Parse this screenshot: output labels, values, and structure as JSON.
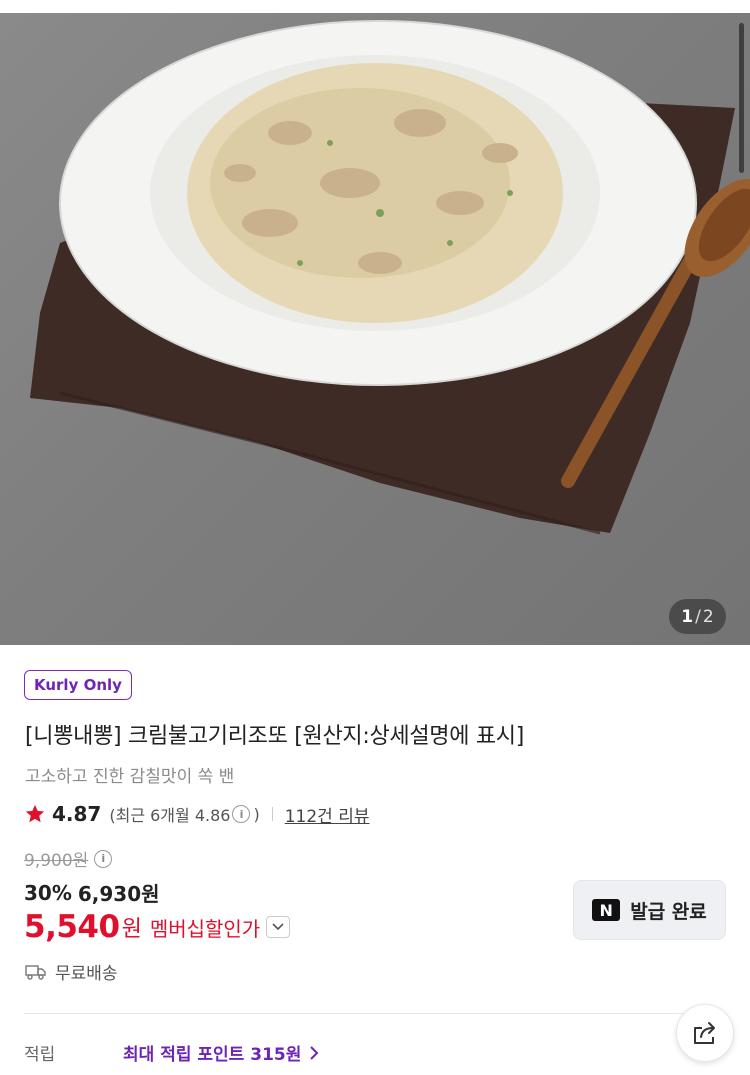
{
  "gallery": {
    "image_alt": "크림불고기리조또",
    "current": "1",
    "separator": "/",
    "total": "2"
  },
  "product": {
    "badge": "Kurly Only",
    "title": "[니뽕내뽕] 크림불고기리조또 [원산지:상세설명에 표시]",
    "subtitle": "고소하고 진한 감칠맛이 쏙 밴"
  },
  "rating": {
    "score": "4.87",
    "recent_prefix": "(최근 6개월 4.86",
    "recent_suffix": ")",
    "review_link": "112건 리뷰",
    "star_color": "#e0102d"
  },
  "price": {
    "original": "9,900원",
    "discount_rate": "30%",
    "sale_price": "6,930원",
    "member_price": "5,540",
    "member_unit": "원",
    "member_label": "멤버십할인가",
    "accent": "#e0102d"
  },
  "naver_button": {
    "logo": "N",
    "label": "발급 완료"
  },
  "shipping": {
    "icon": "truck-icon",
    "label": "무료배송"
  },
  "points": {
    "label": "적립",
    "value": "최대 적립 포인트 315원",
    "color": "#6e25b5"
  },
  "share": {
    "icon": "share-icon"
  }
}
